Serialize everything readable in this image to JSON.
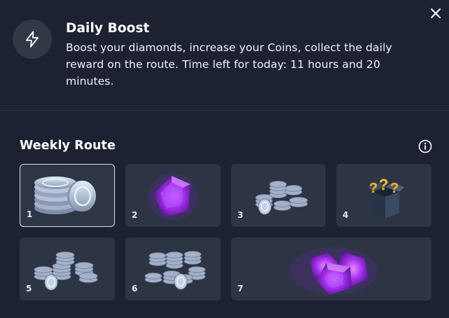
{
  "header": {
    "title": "Daily Boost",
    "description": "Boost your diamonds, increase your Coins, collect the daily reward on the route. Time left for today: 11 hours and 20 minutes."
  },
  "route": {
    "title": "Weekly Route",
    "days": [
      {
        "label": "1",
        "reward": "coins",
        "active": true
      },
      {
        "label": "2",
        "reward": "diamond",
        "active": false
      },
      {
        "label": "3",
        "reward": "coins",
        "active": false
      },
      {
        "label": "4",
        "reward": "mystery-box",
        "active": false
      },
      {
        "label": "5",
        "reward": "coins",
        "active": false
      },
      {
        "label": "6",
        "reward": "coins",
        "active": false
      },
      {
        "label": "7",
        "reward": "diamonds",
        "active": false
      }
    ]
  },
  "colors": {
    "background": "#1c2231",
    "tile": "#2d3443",
    "diamond": "#a93af0",
    "coin": "#b7c3da"
  }
}
